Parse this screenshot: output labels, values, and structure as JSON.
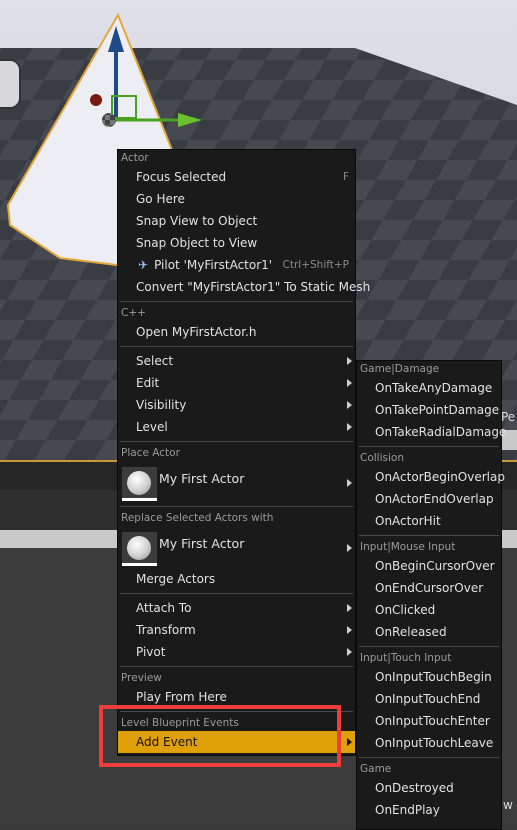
{
  "viewport": {
    "edge_text_top": "Pe",
    "edge_text_bottom": "w"
  },
  "colors": {
    "highlight": "#e0a008",
    "annotation_box": "#ee3b3b",
    "menu_bg": "#1a1a1a"
  },
  "context_menu": {
    "actor_header": "Actor",
    "focus_selected": "Focus Selected",
    "focus_selected_shortcut": "F",
    "go_here": "Go Here",
    "snap_view": "Snap View to Object",
    "snap_object": "Snap Object to View",
    "pilot": "Pilot 'MyFirstActor1'",
    "pilot_icon": "airplane-icon",
    "pilot_shortcut": "Ctrl+Shift+P",
    "convert": "Convert \"MyFirstActor1\" To Static Mesh",
    "cpp_header": "C++",
    "open_header": "Open MyFirstActor.h",
    "select": "Select",
    "edit": "Edit",
    "visibility": "Visibility",
    "level": "Level",
    "place_header": "Place Actor",
    "place_actor": "My First Actor",
    "replace_header": "Replace Selected Actors with",
    "replace_actor": "My First Actor",
    "merge": "Merge Actors",
    "attach": "Attach To",
    "transform": "Transform",
    "pivot": "Pivot",
    "preview_header": "Preview",
    "play_from_here": "Play From Here",
    "lbe_header": "Level Blueprint Events",
    "add_event": "Add Event"
  },
  "submenu": {
    "groups": [
      {
        "header": "Game|Damage",
        "items": [
          "OnTakeAnyDamage",
          "OnTakePointDamage",
          "OnTakeRadialDamage"
        ]
      },
      {
        "header": "Collision",
        "items": [
          "OnActorBeginOverlap",
          "OnActorEndOverlap",
          "OnActorHit"
        ]
      },
      {
        "header": "Input|Mouse Input",
        "items": [
          "OnBeginCursorOver",
          "OnEndCursorOver",
          "OnClicked",
          "OnReleased"
        ]
      },
      {
        "header": "Input|Touch Input",
        "items": [
          "OnInputTouchBegin",
          "OnInputTouchEnd",
          "OnInputTouchEnter",
          "OnInputTouchLeave"
        ]
      },
      {
        "header": "Game",
        "items": [
          "OnDestroyed",
          "OnEndPlay"
        ]
      }
    ]
  }
}
